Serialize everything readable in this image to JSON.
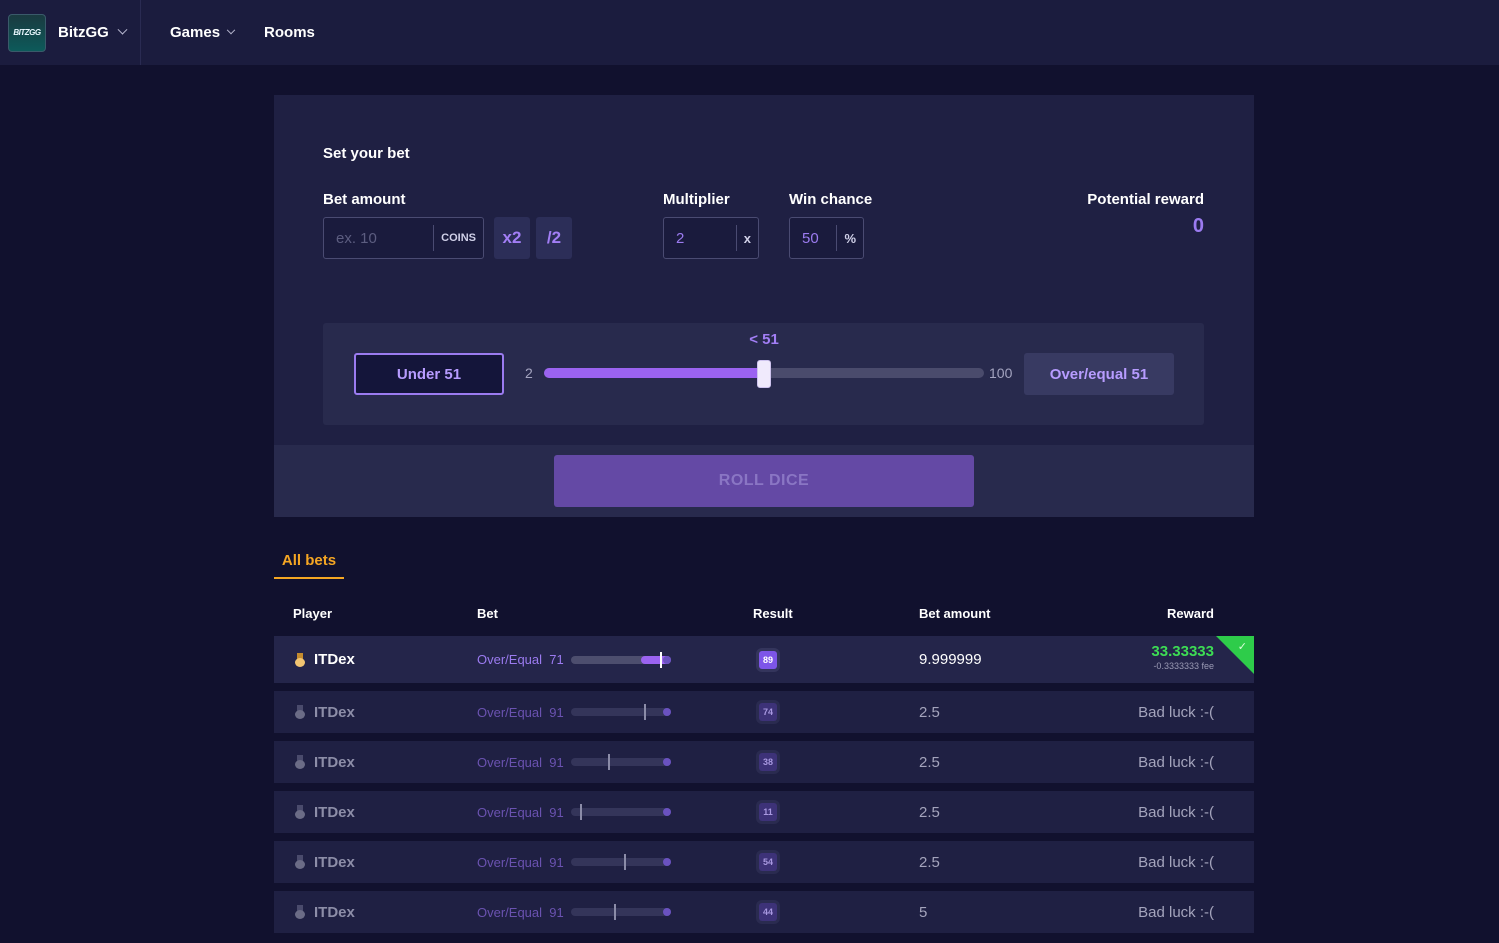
{
  "nav": {
    "logo_text": "BITZGG",
    "brand": "BitzGG",
    "items": [
      {
        "label": "Games",
        "has_dropdown": true
      },
      {
        "label": "Rooms",
        "has_dropdown": false
      }
    ]
  },
  "bet_panel": {
    "title": "Set your bet",
    "bet_amount": {
      "label": "Bet amount",
      "placeholder": "ex. 10",
      "value": "",
      "suffix": "COINS"
    },
    "double_label": "x2",
    "half_label": "/2",
    "multiplier": {
      "label": "Multiplier",
      "value": "2",
      "suffix": "x"
    },
    "win_chance": {
      "label": "Win chance",
      "value": "50",
      "suffix": "%"
    },
    "potential_reward": {
      "label": "Potential reward",
      "value": "0"
    },
    "slider": {
      "under_label": "Under 51",
      "over_label": "Over/equal 51",
      "min": "2",
      "max": "100",
      "current_label": "< 51",
      "value": 51,
      "range_min": 2,
      "range_max": 100
    },
    "roll_label": "ROLL DICE"
  },
  "tabs": [
    {
      "label": "All bets",
      "active": true
    }
  ],
  "table": {
    "headers": {
      "player": "Player",
      "bet": "Bet",
      "result": "Result",
      "amount": "Bet amount",
      "reward": "Reward"
    },
    "rows": [
      {
        "player": "ITDex",
        "bet_type": "Over/Equal",
        "bet_target": "71",
        "target_value": 71,
        "result": "89",
        "result_value": 89,
        "amount": "9.999999",
        "reward": "33.33333",
        "fee": "-0.3333333 fee",
        "win": true
      },
      {
        "player": "ITDex",
        "bet_type": "Over/Equal",
        "bet_target": "91",
        "target_value": 91,
        "result": "74",
        "result_value": 74,
        "amount": "2.5",
        "reward": "Bad luck :-(",
        "win": false
      },
      {
        "player": "ITDex",
        "bet_type": "Over/Equal",
        "bet_target": "91",
        "target_value": 91,
        "result": "38",
        "result_value": 38,
        "amount": "2.5",
        "reward": "Bad luck :-(",
        "win": false
      },
      {
        "player": "ITDex",
        "bet_type": "Over/Equal",
        "bet_target": "91",
        "target_value": 91,
        "result": "11",
        "result_value": 11,
        "amount": "2.5",
        "reward": "Bad luck :-(",
        "win": false
      },
      {
        "player": "ITDex",
        "bet_type": "Over/Equal",
        "bet_target": "91",
        "target_value": 91,
        "result": "54",
        "result_value": 54,
        "amount": "2.5",
        "reward": "Bad luck :-(",
        "win": false
      },
      {
        "player": "ITDex",
        "bet_type": "Over/Equal",
        "bet_target": "91",
        "target_value": 91,
        "result": "44",
        "result_value": 44,
        "amount": "5",
        "reward": "Bad luck :-(",
        "win": false
      }
    ]
  },
  "colors": {
    "accent": "#9b7bf0",
    "win": "#3ddc54",
    "tab_active": "#f5a623"
  }
}
